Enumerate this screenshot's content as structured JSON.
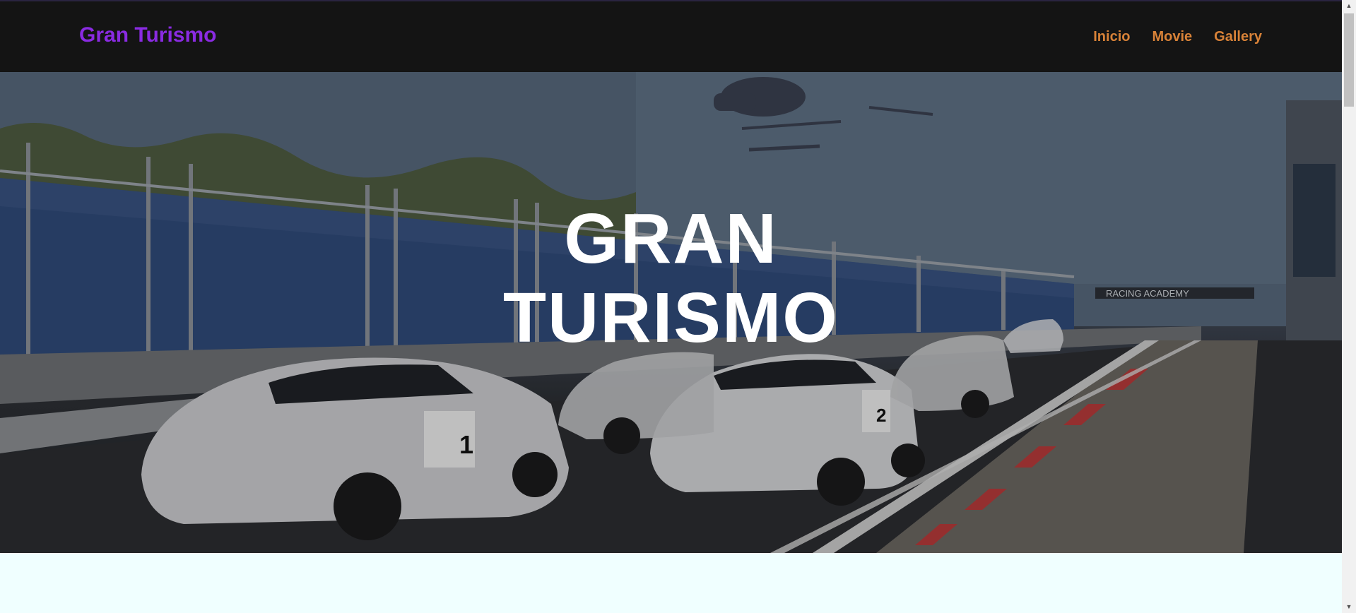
{
  "navbar": {
    "brand": "Gran Turismo",
    "links": [
      {
        "label": "Inicio"
      },
      {
        "label": "Movie"
      },
      {
        "label": "Gallery"
      }
    ]
  },
  "hero": {
    "title_line1": "GRAN",
    "title_line2": "TURISMO",
    "banner_text": "RACING ACADEMY",
    "car_numbers": [
      "1",
      "2"
    ]
  },
  "colors": {
    "brand": "#8a2be2",
    "nav_link": "#d88238",
    "navbar_bg": "#141414",
    "page_bg": "#f0ffff"
  },
  "icons": {
    "scroll_up": "triangle-up-icon",
    "scroll_down": "triangle-down-icon"
  }
}
